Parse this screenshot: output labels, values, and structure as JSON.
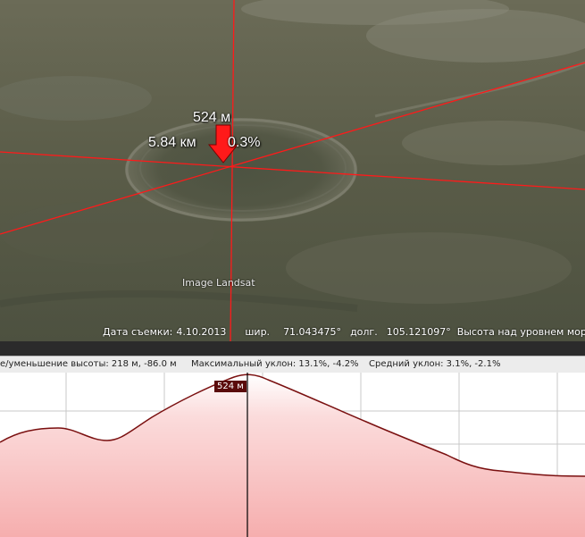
{
  "overlay": {
    "elevation": "524 м",
    "distance": "5.84 км",
    "slope": "0.3%",
    "imagery_credit": "Image Landsat"
  },
  "status_bar": {
    "date_label": "Дата съемки:",
    "date_value": "4.10.2013",
    "lat_label": "шир.",
    "lat_value": "71.043475°",
    "lon_label": "долг.",
    "lon_value": "105.121097°",
    "altitude_label": "Высота над уровнем мор"
  },
  "profile_stats": {
    "gain_loss": "е/уменьшение высоты: 218 м, -86.0 м",
    "max_slope": "Максимальный уклон: 13.1%, -4.2%",
    "avg_slope": "Средний уклон: 3.1%, -2.1%"
  },
  "profile_marker": {
    "label": "524 м"
  },
  "colors": {
    "line": "#ff1a1a",
    "profile_line": "#7a1010",
    "profile_fill_top": "#f7b9b9",
    "arrow": "#ff1a1a"
  },
  "icons": [
    "red-down-arrow-icon"
  ]
}
